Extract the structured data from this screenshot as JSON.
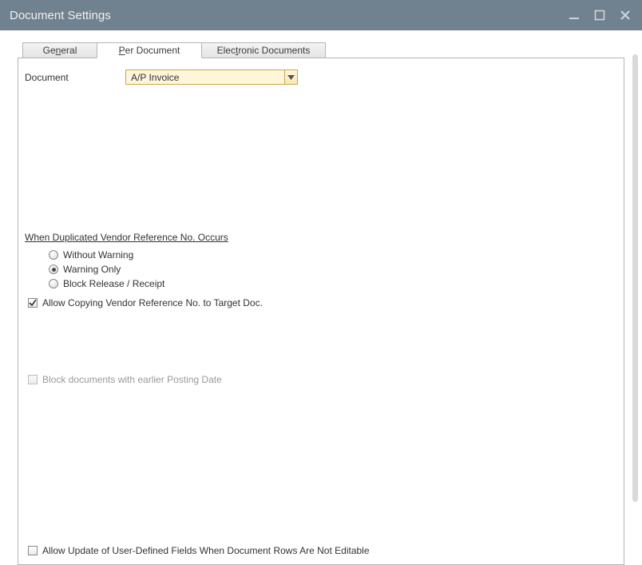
{
  "window": {
    "title": "Document Settings"
  },
  "tabs": {
    "general": {
      "pre": "Ge",
      "hot": "n",
      "post": "eral"
    },
    "per_document": {
      "pre": "",
      "hot": "P",
      "post": "er Document"
    },
    "electronic_documents": {
      "pre": "Elec",
      "hot": "t",
      "post": "ronic Documents"
    }
  },
  "fields": {
    "document_label": "Document",
    "document_value": "A/P Invoice"
  },
  "dup_vendor_ref": {
    "heading": "When Duplicated Vendor Reference No. Occurs",
    "without_warning": "Without Warning",
    "warning_only": "Warning Only",
    "block_release_receipt": "Block Release / Receipt",
    "selected": "warning_only"
  },
  "checks": {
    "allow_copy_vendor_ref": {
      "label": "Allow Copying Vendor Reference No. to Target Doc.",
      "checked": true
    },
    "block_earlier_posting": {
      "label": "Block documents with earlier Posting Date",
      "checked": false,
      "enabled": false
    },
    "allow_update_udf": {
      "label": "Allow Update of User-Defined Fields When Document Rows Are Not Editable",
      "checked": false
    }
  }
}
